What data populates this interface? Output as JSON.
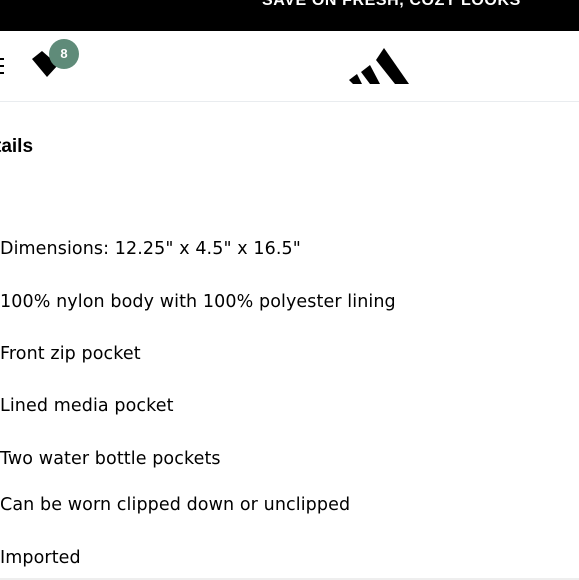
{
  "promo": {
    "text": "SAVE ON FRESH, COZY LOOKS"
  },
  "header": {
    "wishlist_count": "8",
    "logo_icon": "adidas-logo-icon",
    "badge_color": "#5f8b79"
  },
  "details": {
    "title": "tails",
    "items": [
      "Dimensions: 12.25\" x 4.5\" x 16.5\"",
      "100% nylon body with 100% polyester lining",
      "Front zip pocket",
      "Lined media pocket",
      "Two water bottle pockets",
      "Can be worn clipped down or unclipped",
      "Imported"
    ]
  }
}
